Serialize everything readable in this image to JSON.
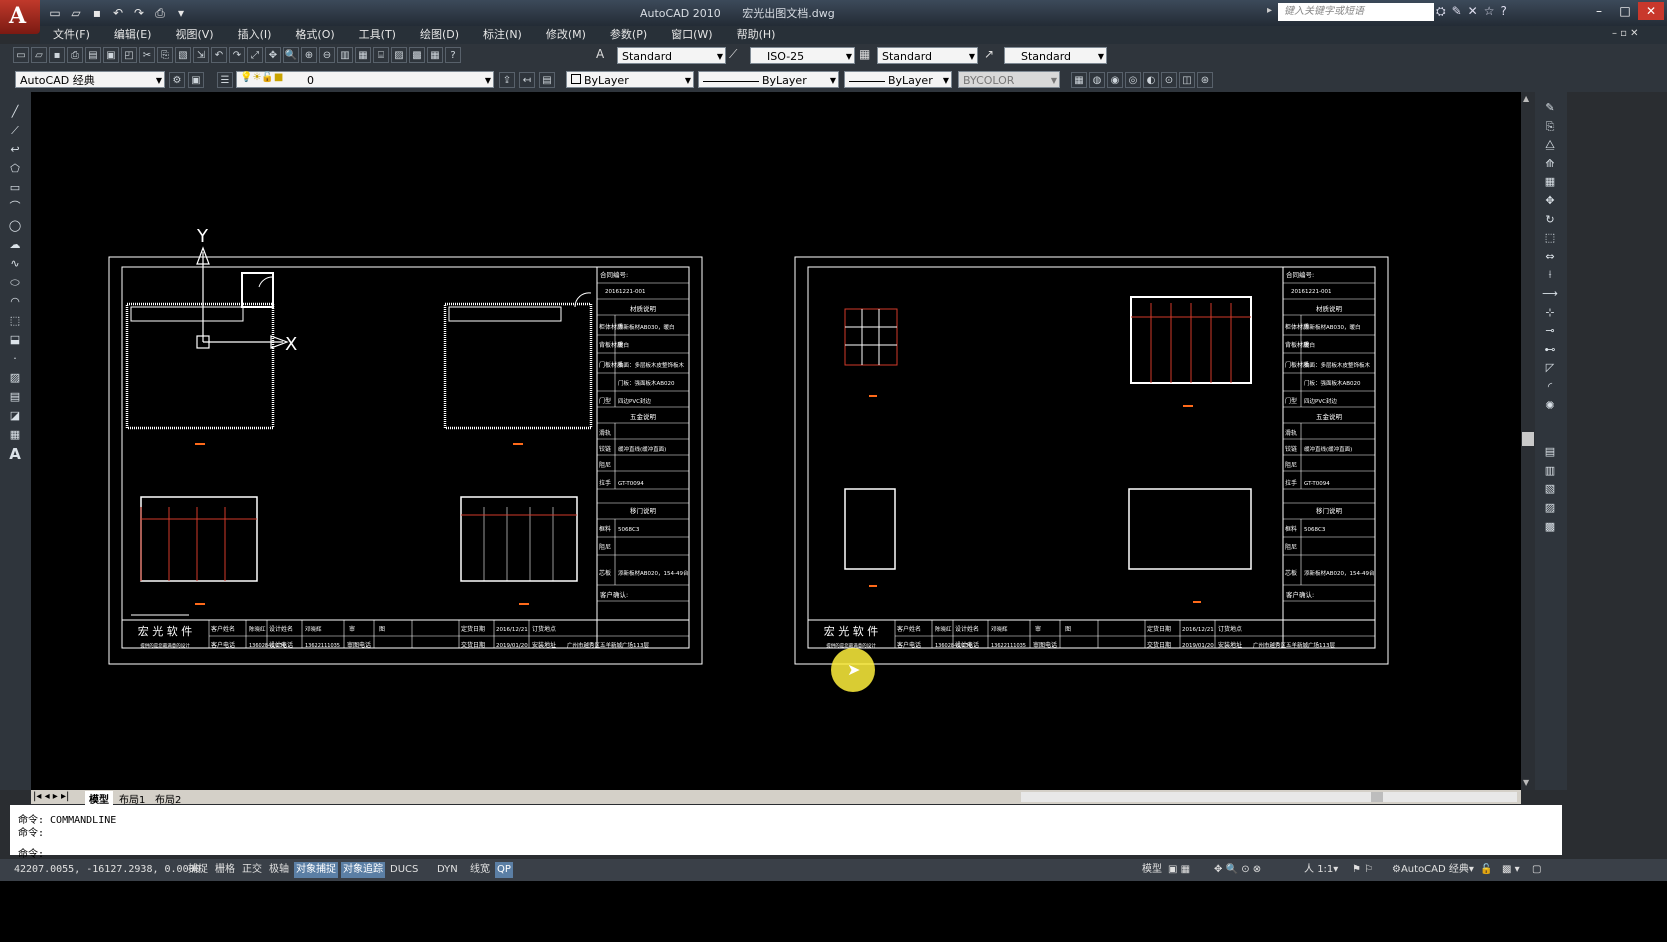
{
  "window": {
    "title": "AutoCAD 2010",
    "file": "宏光出图文档.dwg",
    "search_placeholder": "键入关键字或短语"
  },
  "menu": [
    "文件(F)",
    "编辑(E)",
    "视图(V)",
    "插入(I)",
    "格式(O)",
    "工具(T)",
    "绘图(D)",
    "标注(N)",
    "修改(M)",
    "参数(P)",
    "窗口(W)",
    "帮助(H)"
  ],
  "styles": {
    "text_style": "Standard",
    "dim_style": "ISO-25",
    "table_style": "Standard",
    "mleader_style": "Standard"
  },
  "workspace": "AutoCAD 经典",
  "layer": "0",
  "properties": {
    "color": "ByLayer",
    "linetype": "ByLayer",
    "lineweight": "ByLayer",
    "plotstyle": "BYCOLOR"
  },
  "ucs": {
    "y": "Y",
    "x": "X"
  },
  "titleblock": {
    "contract_no_label": "合同编号:",
    "contract_no": "20161221-001",
    "material_title": "材质说明",
    "rows": [
      {
        "label": "柜体材质",
        "value": "添新板材AB030，暖白"
      },
      {
        "label": "背板材质",
        "value": "暖白"
      },
      {
        "label": "门板材质",
        "value": "抽面：多层板木皮整饰板木"
      },
      {
        "label": "",
        "value": "门板：强面板木AB020"
      },
      {
        "label": "门型",
        "value": "四边PVC封边"
      }
    ],
    "hardware_title": "五金说明",
    "hw_rows": [
      {
        "label": "滑轨",
        "value": ""
      },
      {
        "label": "铰链",
        "value": "缓冲直线(缓冲直面)"
      },
      {
        "label": "阻尼",
        "value": ""
      },
      {
        "label": "拉手",
        "value": "GT-T0094"
      }
    ],
    "sliding_title": "移门说明",
    "sl_rows": [
      {
        "label": "框料",
        "value": "5068C3"
      },
      {
        "label": "阻尼",
        "value": ""
      },
      {
        "label": "芯板",
        "value": "添新板材AB020，154-49台"
      }
    ],
    "customer_confirm": "客户确认:",
    "company": "宏 光 软 件",
    "company_sub": "提供的是您最满意的设计",
    "cust_name_label": "客户姓名",
    "cust_name": "陈晓红",
    "designer_label": "设计姓名",
    "designer": "邓晓辉",
    "review_label": "审",
    "review2": "图",
    "order_date_label": "定货日期",
    "order_date": "2016/12/21",
    "order_addr_label": "订货地点",
    "cust_phone_label": "客户电话",
    "cust_phone": "13602846/130",
    "design_phone_label": "设计电话",
    "design_phone": "13622111035",
    "review_phone_label": "审图电话",
    "delivery_label": "交货日期",
    "delivery_date": "2019/01/20",
    "install_label": "安装地址",
    "install_addr": "广州市越秀区五羊新城广场113层"
  },
  "tabs": {
    "model": "模型",
    "layout1": "布局1",
    "layout2": "布局2"
  },
  "command": {
    "line1": "命令: COMMANDLINE",
    "line2": "命令:",
    "line3": "命令:"
  },
  "status": {
    "coords": "42207.0055, -16127.2938, 0.0000",
    "buttons": [
      {
        "label": "捕捉",
        "on": false
      },
      {
        "label": "栅格",
        "on": false
      },
      {
        "label": "正交",
        "on": false
      },
      {
        "label": "极轴",
        "on": false
      },
      {
        "label": "对象捕捉",
        "on": true
      },
      {
        "label": "对象追踪",
        "on": true
      },
      {
        "label": "DUCS",
        "on": false
      },
      {
        "label": "DYN",
        "on": false
      },
      {
        "label": "线宽",
        "on": false
      },
      {
        "label": "QP",
        "on": true
      }
    ],
    "model": "模型",
    "scale": "1:1",
    "workspace": "AutoCAD 经典"
  }
}
